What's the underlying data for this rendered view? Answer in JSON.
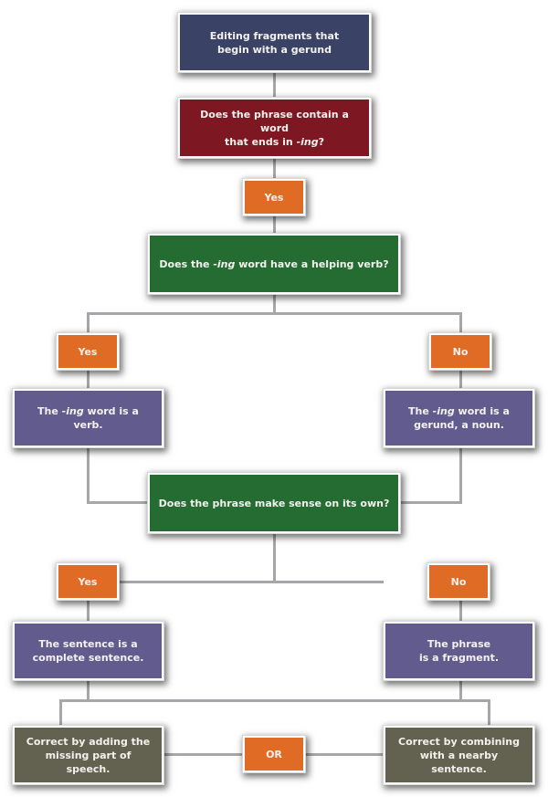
{
  "colors": {
    "navy": "#3a4266",
    "red": "#7d1721",
    "orange": "#e06b24",
    "green": "#256c33",
    "purple": "#625c8e",
    "olive": "#636150",
    "connector": "#a7a7ab"
  },
  "flowchart": {
    "title_box": {
      "line1": "Editing fragments that",
      "line2": "begin with a gerund"
    },
    "question1": {
      "pre": "Does the phrase contain a word",
      "line2_pre": "that ends in ",
      "italic": "-ing",
      "post": "?"
    },
    "answer1_yes": "Yes",
    "question2": {
      "pre": "Does the ",
      "italic": "-ing",
      "post": " word have a helping verb?"
    },
    "branch2": {
      "yes_label": "Yes",
      "no_label": "No",
      "yes_result": {
        "pre": "The ",
        "italic": "-ing",
        "post": " word is a verb."
      },
      "no_result": {
        "pre": "The ",
        "italic": "-ing",
        "post": " word is a",
        "line2": "gerund, a noun."
      }
    },
    "question3": "Does the phrase make sense on its own?",
    "branch3": {
      "yes_label": "Yes",
      "no_label": "No",
      "yes_result": {
        "line1": "The sentence is a",
        "line2": "complete sentence."
      },
      "no_result": {
        "line1": "The phrase",
        "line2": "is a fragment."
      }
    },
    "corrections": {
      "left": {
        "line1": "Correct by adding the",
        "line2": "missing part of speech."
      },
      "or_label": "OR",
      "right": {
        "line1": "Correct by combining",
        "line2": "with a nearby sentence."
      }
    }
  }
}
